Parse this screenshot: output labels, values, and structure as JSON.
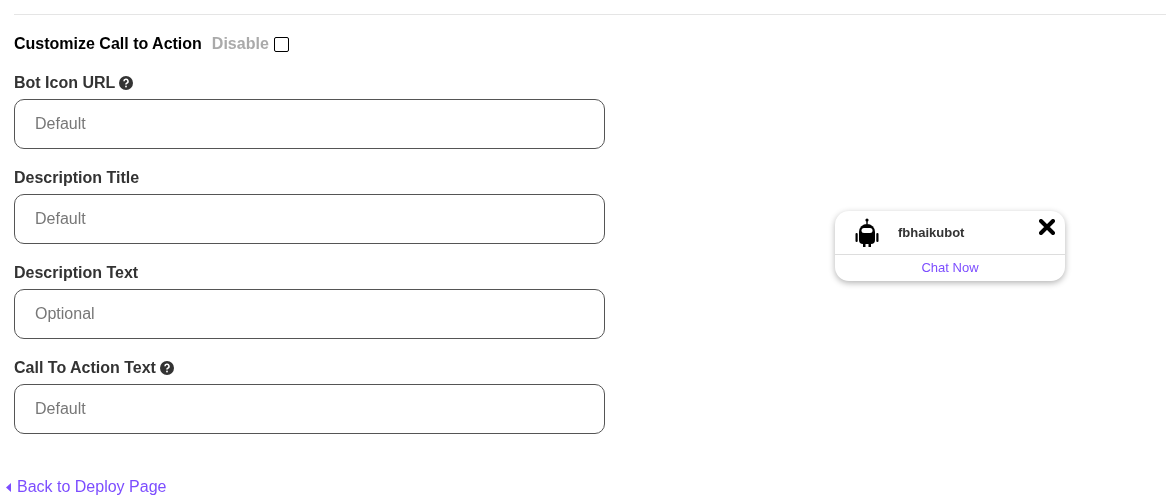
{
  "section": {
    "title": "Customize Call to Action",
    "disable_label": "Disable",
    "disabled": false
  },
  "fields": [
    {
      "label": "Bot Icon URL",
      "help": true,
      "placeholder": "Default"
    },
    {
      "label": "Description Title",
      "help": false,
      "placeholder": "Default"
    },
    {
      "label": "Description Text",
      "help": false,
      "placeholder": "Optional"
    },
    {
      "label": "Call To Action Text",
      "help": true,
      "placeholder": "Default"
    }
  ],
  "preview": {
    "bot_name": "fbhaikubot",
    "action": "Chat Now"
  },
  "back_link": "Back to Deploy Page"
}
